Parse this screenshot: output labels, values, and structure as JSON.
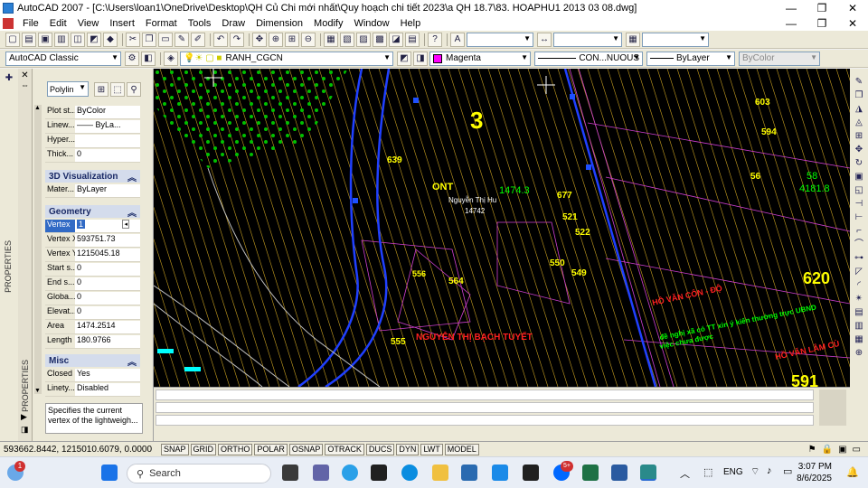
{
  "window": {
    "title": "AutoCAD 2007 - [C:\\Users\\loan1\\OneDrive\\Desktop\\QH Củ Chi mới nhất\\Quy hoạch chi tiết 2023\\a QH 18.7\\83. HOAPHU1 2013 03 08.dwg]",
    "minimize": "—",
    "restore": "❐",
    "close": "✕"
  },
  "menu": {
    "items": [
      "File",
      "Edit",
      "View",
      "Insert",
      "Format",
      "Tools",
      "Draw",
      "Dimension",
      "Modify",
      "Window",
      "Help"
    ],
    "doc_min": "—",
    "doc_restore": "❐",
    "doc_close": "✕"
  },
  "toolbar": {
    "workspace": "AutoCAD Classic",
    "layer": "RANH_CGCN",
    "color": "Magenta",
    "linetype": "CON...NUOUS",
    "lineweight": "ByLayer",
    "plotstyle": "ByColor"
  },
  "properties": {
    "panel_title": "PROPERTIES",
    "object_type": "Polylin",
    "rows_general": [
      {
        "k": "Plot st...",
        "v": "ByColor"
      },
      {
        "k": "Linew...",
        "v": "—— ByLa..."
      },
      {
        "k": "Hyper...",
        "v": ""
      },
      {
        "k": "Thick...",
        "v": "0"
      }
    ],
    "section_3d": "3D Visualization",
    "rows_3d": [
      {
        "k": "Mater...",
        "v": "ByLayer"
      }
    ],
    "section_geometry": "Geometry",
    "rows_geometry": [
      {
        "k": "Vertex",
        "v": "1"
      },
      {
        "k": "Vertex X",
        "v": "593751.73"
      },
      {
        "k": "Vertex Y",
        "v": "1215045.18"
      },
      {
        "k": "Start s...",
        "v": "0"
      },
      {
        "k": "End s...",
        "v": "0"
      },
      {
        "k": "Globa...",
        "v": "0"
      },
      {
        "k": "Elevat...",
        "v": "0"
      },
      {
        "k": "Area",
        "v": "1474.2514"
      },
      {
        "k": "Length",
        "v": "180.9766"
      }
    ],
    "section_misc": "Misc",
    "rows_misc": [
      {
        "k": "Closed",
        "v": "Yes"
      },
      {
        "k": "Linety...",
        "v": "Disabled"
      }
    ],
    "description": "Specifies the current vertex of the lightweigh..."
  },
  "drawing_labels": [
    {
      "text": "3",
      "color": "#ffff00"
    },
    {
      "text": "603",
      "color": "#ffff00"
    },
    {
      "text": "594",
      "color": "#ffff00"
    },
    {
      "text": "56",
      "color": "#ffff00"
    },
    {
      "text": "58",
      "color": "#00ff00"
    },
    {
      "text": "4181.8",
      "color": "#00ff00"
    },
    {
      "text": "620",
      "color": "#ffff00"
    },
    {
      "text": "591",
      "color": "#ffff00"
    },
    {
      "text": "677",
      "color": "#ffff00"
    },
    {
      "text": "521",
      "color": "#ffff00"
    },
    {
      "text": "522",
      "color": "#ffff00"
    },
    {
      "text": "550",
      "color": "#ffff00"
    },
    {
      "text": "549",
      "color": "#ffff00"
    },
    {
      "text": "564",
      "color": "#ffff00"
    },
    {
      "text": "556",
      "color": "#ffff00"
    },
    {
      "text": "555",
      "color": "#ffff00"
    },
    {
      "text": "639",
      "color": "#ffff00"
    },
    {
      "text": "ONT",
      "color": "#ffff00"
    },
    {
      "text": "1474.3",
      "color": "#00ff00"
    },
    {
      "text": "Nguyễn Thị Hu",
      "color": "#ffffff"
    },
    {
      "text": "14742",
      "color": "#ffffff"
    },
    {
      "text": "HỒ VĂN CÔN - ĐỘ",
      "color": "#ff2020"
    },
    {
      "text": "HỒ VĂN LÂM CÙ",
      "color": "#ff2020"
    },
    {
      "text": "NGUYỄN THỊ BẠCH TUYẾT",
      "color": "#ff2020"
    },
    {
      "text": "đề nghị xã có TT xin ý kiến thường trực UBND",
      "color": "#00ff00"
    },
    {
      "text": "việc chưa được",
      "color": "#00ff00"
    }
  ],
  "status": {
    "coords": "593662.8442, 1215010.6079, 0.0000",
    "buttons": [
      "SNAP",
      "GRID",
      "ORTHO",
      "POLAR",
      "OSNAP",
      "OTRACK",
      "DUCS",
      "DYN",
      "LWT",
      "MODEL"
    ]
  },
  "taskbar": {
    "search": "Search",
    "lang": "ENG",
    "time": "3:07 PM",
    "date": "8/6/2025",
    "notify_badge": "1",
    "zalo_badge": "5+"
  }
}
